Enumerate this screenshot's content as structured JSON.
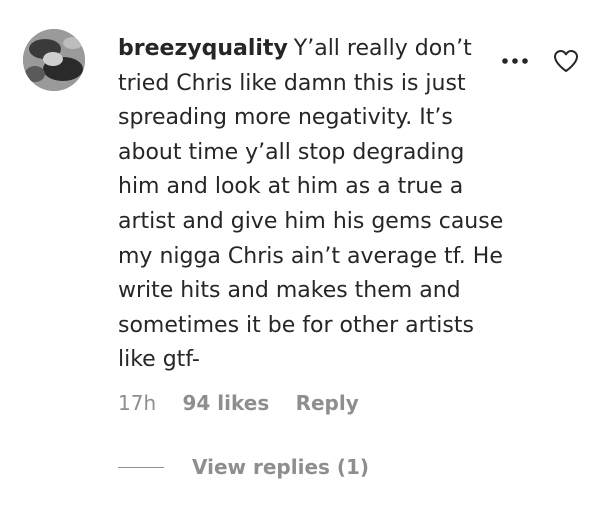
{
  "comment": {
    "avatar_icon": "profile-photo",
    "username": "breezyquality",
    "text": "Y’all really don’t tried Chris like damn this is just spreading more negativity. It’s about time y’all stop degrading him and look at him as a true a artist and give him his gems cause my nigga Chris ain’t average tf. He write hits and makes them and sometimes it be for other artists like gtf-",
    "time": "17h",
    "likes": "94 likes",
    "reply_label": "Reply",
    "view_replies_label": "View replies (1)",
    "more_icon": "ellipsis-icon",
    "like_icon": "heart-outline-icon"
  },
  "colors": {
    "text": "#262626",
    "secondary": "#8e8e8e",
    "background": "#ffffff"
  }
}
